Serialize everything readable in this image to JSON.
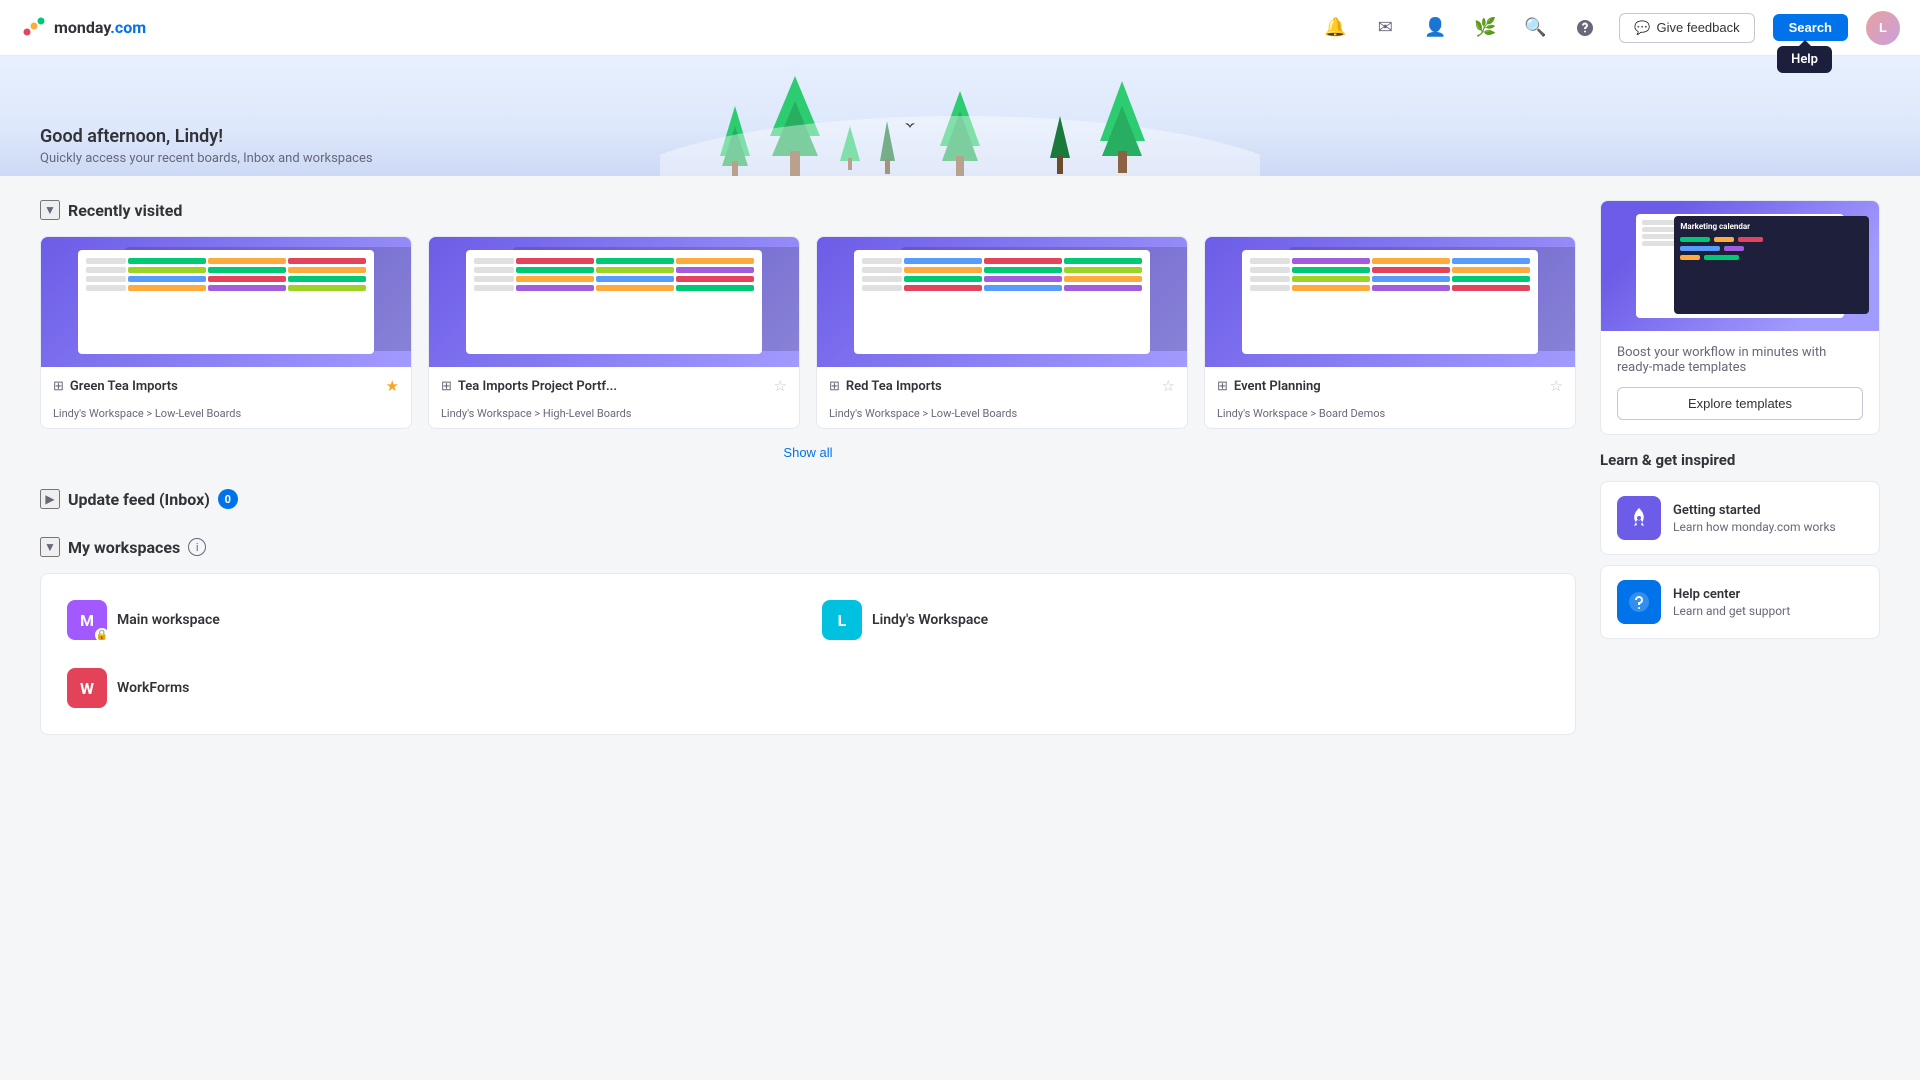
{
  "app": {
    "name": "monday",
    "domain": ".com"
  },
  "topnav": {
    "give_feedback_label": "Give feedback",
    "search_label": "Search",
    "help_tooltip": "Help",
    "avatar_initials": "L"
  },
  "hero": {
    "greeting": "Good afternoon, Lindy!",
    "subtitle": "Quickly access your recent boards, Inbox and workspaces"
  },
  "recently_visited": {
    "title": "Recently visited",
    "show_all_label": "Show all",
    "cards": [
      {
        "name": "Green Tea Imports",
        "path": "Lindy's Workspace > Low-Level Boards",
        "starred": true,
        "icon": "board"
      },
      {
        "name": "Tea Imports Project Portf...",
        "path": "Lindy's Workspace > High-Level Boards",
        "starred": false,
        "icon": "board"
      },
      {
        "name": "Red Tea Imports",
        "path": "Lindy's Workspace > Low-Level Boards",
        "starred": false,
        "icon": "board"
      },
      {
        "name": "Event Planning",
        "path": "Lindy's Workspace > Board Demos",
        "starred": false,
        "icon": "board"
      }
    ]
  },
  "update_feed": {
    "title": "Update feed (Inbox)",
    "badge_count": "0"
  },
  "my_workspaces": {
    "title": "My workspaces",
    "workspaces": [
      {
        "name": "Main workspace",
        "initial": "M",
        "color": "#a259ff",
        "has_lock": true
      },
      {
        "name": "Lindy's Workspace",
        "initial": "L",
        "color": "#00c2e0",
        "has_lock": false
      },
      {
        "name": "WorkForms",
        "initial": "W",
        "color": "#e44258",
        "has_lock": false
      }
    ]
  },
  "sidebar_right": {
    "template_boost_text": "Boost your workflow in minutes with ready-made templates",
    "explore_templates_label": "Explore templates",
    "learn_title": "Learn & get inspired",
    "learn_cards": [
      {
        "title": "Getting started",
        "desc": "Learn how monday.com works",
        "icon": "rocket",
        "color": "#6c5ce7"
      },
      {
        "title": "Help center",
        "desc": "Learn and get support",
        "icon": "question",
        "color": "#0073ea"
      }
    ]
  },
  "colors": {
    "cell_green": "#00c875",
    "cell_orange": "#fdab3d",
    "cell_red": "#e2445c",
    "cell_yellow": "#ffcb00",
    "cell_purple": "#a25ddc",
    "cell_blue": "#579bfc",
    "cell_light_green": "#9cd326"
  }
}
